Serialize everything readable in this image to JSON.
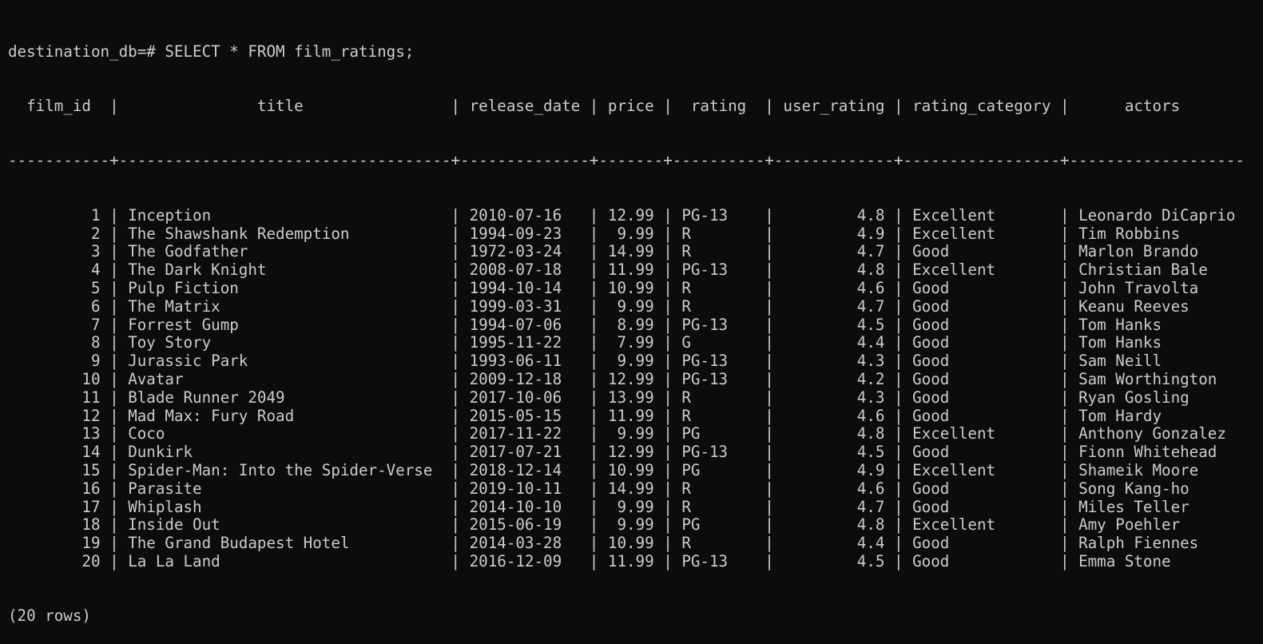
{
  "terminal": {
    "prompt": "destination_db=#",
    "command": "SELECT * FROM film_ratings;",
    "row_count": "(20 rows)"
  },
  "table": {
    "columns": [
      {
        "key": "film_id",
        "label": "film_id",
        "width": 9,
        "align": "right"
      },
      {
        "key": "title",
        "label": "title",
        "width": 34,
        "align": "left"
      },
      {
        "key": "release_date",
        "label": "release_date",
        "width": 12,
        "align": "left"
      },
      {
        "key": "price",
        "label": "price",
        "width": 5,
        "align": "right"
      },
      {
        "key": "rating",
        "label": "rating",
        "width": 8,
        "align": "left"
      },
      {
        "key": "user_rating",
        "label": "user_rating",
        "width": 11,
        "align": "right"
      },
      {
        "key": "rating_category",
        "label": "rating_category",
        "width": 15,
        "align": "left"
      },
      {
        "key": "actors",
        "label": "actors",
        "width": 17,
        "align": "left"
      }
    ],
    "rows": [
      [
        "1",
        "Inception",
        "2010-07-16",
        "12.99",
        "PG-13",
        "4.8",
        "Excellent",
        "Leonardo DiCaprio"
      ],
      [
        "2",
        "The Shawshank Redemption",
        "1994-09-23",
        "9.99",
        "R",
        "4.9",
        "Excellent",
        "Tim Robbins"
      ],
      [
        "3",
        "The Godfather",
        "1972-03-24",
        "14.99",
        "R",
        "4.7",
        "Good",
        "Marlon Brando"
      ],
      [
        "4",
        "The Dark Knight",
        "2008-07-18",
        "11.99",
        "PG-13",
        "4.8",
        "Excellent",
        "Christian Bale"
      ],
      [
        "5",
        "Pulp Fiction",
        "1994-10-14",
        "10.99",
        "R",
        "4.6",
        "Good",
        "John Travolta"
      ],
      [
        "6",
        "The Matrix",
        "1999-03-31",
        "9.99",
        "R",
        "4.7",
        "Good",
        "Keanu Reeves"
      ],
      [
        "7",
        "Forrest Gump",
        "1994-07-06",
        "8.99",
        "PG-13",
        "4.5",
        "Good",
        "Tom Hanks"
      ],
      [
        "8",
        "Toy Story",
        "1995-11-22",
        "7.99",
        "G",
        "4.4",
        "Good",
        "Tom Hanks"
      ],
      [
        "9",
        "Jurassic Park",
        "1993-06-11",
        "9.99",
        "PG-13",
        "4.3",
        "Good",
        "Sam Neill"
      ],
      [
        "10",
        "Avatar",
        "2009-12-18",
        "12.99",
        "PG-13",
        "4.2",
        "Good",
        "Sam Worthington"
      ],
      [
        "11",
        "Blade Runner 2049",
        "2017-10-06",
        "13.99",
        "R",
        "4.3",
        "Good",
        "Ryan Gosling"
      ],
      [
        "12",
        "Mad Max: Fury Road",
        "2015-05-15",
        "11.99",
        "R",
        "4.6",
        "Good",
        "Tom Hardy"
      ],
      [
        "13",
        "Coco",
        "2017-11-22",
        "9.99",
        "PG",
        "4.8",
        "Excellent",
        "Anthony Gonzalez"
      ],
      [
        "14",
        "Dunkirk",
        "2017-07-21",
        "12.99",
        "PG-13",
        "4.5",
        "Good",
        "Fionn Whitehead"
      ],
      [
        "15",
        "Spider-Man: Into the Spider-Verse",
        "2018-12-14",
        "10.99",
        "PG",
        "4.9",
        "Excellent",
        "Shameik Moore"
      ],
      [
        "16",
        "Parasite",
        "2019-10-11",
        "14.99",
        "R",
        "4.6",
        "Good",
        "Song Kang-ho"
      ],
      [
        "17",
        "Whiplash",
        "2014-10-10",
        "9.99",
        "R",
        "4.7",
        "Good",
        "Miles Teller"
      ],
      [
        "18",
        "Inside Out",
        "2015-06-19",
        "9.99",
        "PG",
        "4.8",
        "Excellent",
        "Amy Poehler"
      ],
      [
        "19",
        "The Grand Budapest Hotel",
        "2014-03-28",
        "10.99",
        "R",
        "4.4",
        "Good",
        "Ralph Fiennes"
      ],
      [
        "20",
        "La La Land",
        "2016-12-09",
        "11.99",
        "PG-13",
        "4.5",
        "Good",
        "Emma Stone"
      ]
    ]
  },
  "colors": {
    "background": "#0c0c0c",
    "foreground": "#cccccc"
  }
}
